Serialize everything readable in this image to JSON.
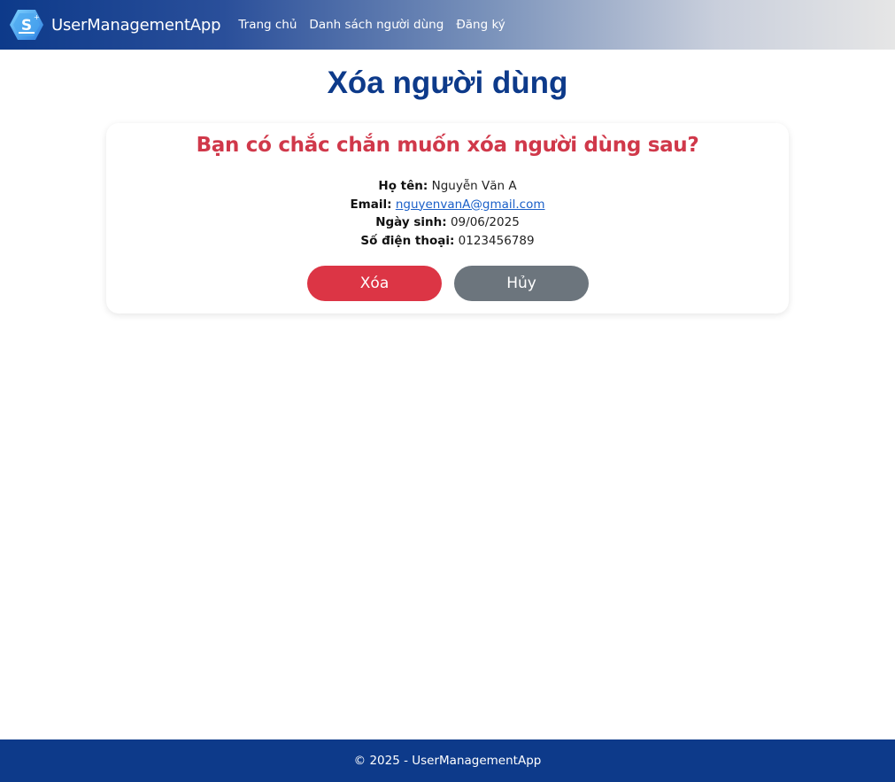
{
  "navbar": {
    "brand_name": "UserManagementApp",
    "links": [
      {
        "label": "Trang chủ"
      },
      {
        "label": "Danh sách người dùng"
      },
      {
        "label": "Đăng ký"
      }
    ]
  },
  "main": {
    "title": "Xóa người dùng",
    "confirm_text": "Bạn có chắc chắn muốn xóa người dùng sau?",
    "fields": {
      "name_label": "Họ tên:",
      "name_value": "Nguyễn Văn A",
      "email_label": "Email:",
      "email_value": "nguyenvanA@gmail.com",
      "dob_label": "Ngày sinh:",
      "dob_value": "09/06/2025",
      "phone_label": "Số điện thoại:",
      "phone_value": "0123456789"
    },
    "delete_button": "Xóa",
    "cancel_button": "Hủy"
  },
  "footer": {
    "text": "© 2025 - UserManagementApp"
  },
  "colors": {
    "primary": "#0d3a8a",
    "danger": "#dc3545",
    "secondary": "#6c757d",
    "confirm_text": "#d0384a"
  }
}
